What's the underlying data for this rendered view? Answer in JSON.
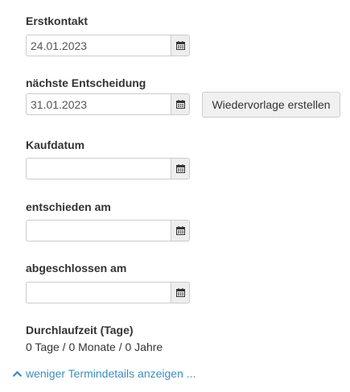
{
  "fields": [
    {
      "label": "Erstkontakt",
      "value": "24.01.2023",
      "icon": "calendar-icon"
    },
    {
      "label": "nächste Entscheidung",
      "value": "31.01.2023",
      "icon": "calendar-icon"
    },
    {
      "label": "Kaufdatum",
      "value": "",
      "icon": "calendar-icon"
    },
    {
      "label": "entschieden am",
      "value": "",
      "icon": "calendar-icon"
    },
    {
      "label": "abgeschlossen am",
      "value": "",
      "icon": "calendar-icon"
    }
  ],
  "followup_button": {
    "label": "Wiedervorlage erstellen"
  },
  "duration": {
    "label": "Durchlaufzeit (Tage)",
    "value": "0 Tage / 0 Monate / 0 Jahre"
  },
  "toggle_link": {
    "label": "weniger Termindetails anzeigen ...",
    "icon": "chevron-up-icon",
    "color": "#3c8dbc"
  }
}
